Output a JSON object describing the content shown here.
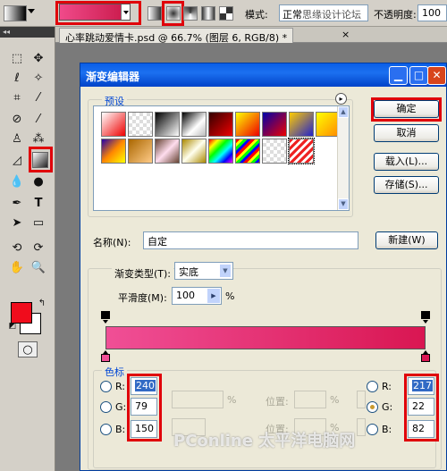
{
  "options_bar": {
    "mode_label": "模式:",
    "mode_value": "正常",
    "mode_overlay": "思缘设计论坛",
    "opacity_label": "不透明度:",
    "opacity_value": "100"
  },
  "document": {
    "tab_title": "心率跳动爱情卡.psd @ 66.7% (图层 6, RGB/8) *",
    "close": "×"
  },
  "dialog": {
    "title": "渐变编辑器",
    "window_buttons": {
      "minimize": "▁",
      "maximize": "□",
      "close": "✕"
    },
    "presets_label": "预设",
    "buttons": {
      "ok": "确定",
      "cancel": "取消",
      "load": "载入(L)...",
      "save": "存储(S)...",
      "new": "新建(W)"
    },
    "name_label": "名称(N):",
    "name_value": "自定",
    "gradient_type_label": "渐变类型(T):",
    "gradient_type_value": "实底",
    "smoothness_label": "平滑度(M):",
    "smoothness_value": "100",
    "smoothness_unit": "%",
    "gradient_colors": {
      "start": "#f04f96",
      "end": "#d91652"
    },
    "stops_group_label": "色标",
    "left_color": {
      "r_label": "R:",
      "g_label": "G:",
      "b_label": "B:",
      "r": "240",
      "g": "79",
      "b": "150"
    },
    "right_color": {
      "r_label": "R:",
      "g_label": "G:",
      "b_label": "B:",
      "r": "217",
      "g": "22",
      "b": "82"
    },
    "position_label": "位置:",
    "percent": "%"
  },
  "watermark": "PConline 太平洋电脑网"
}
